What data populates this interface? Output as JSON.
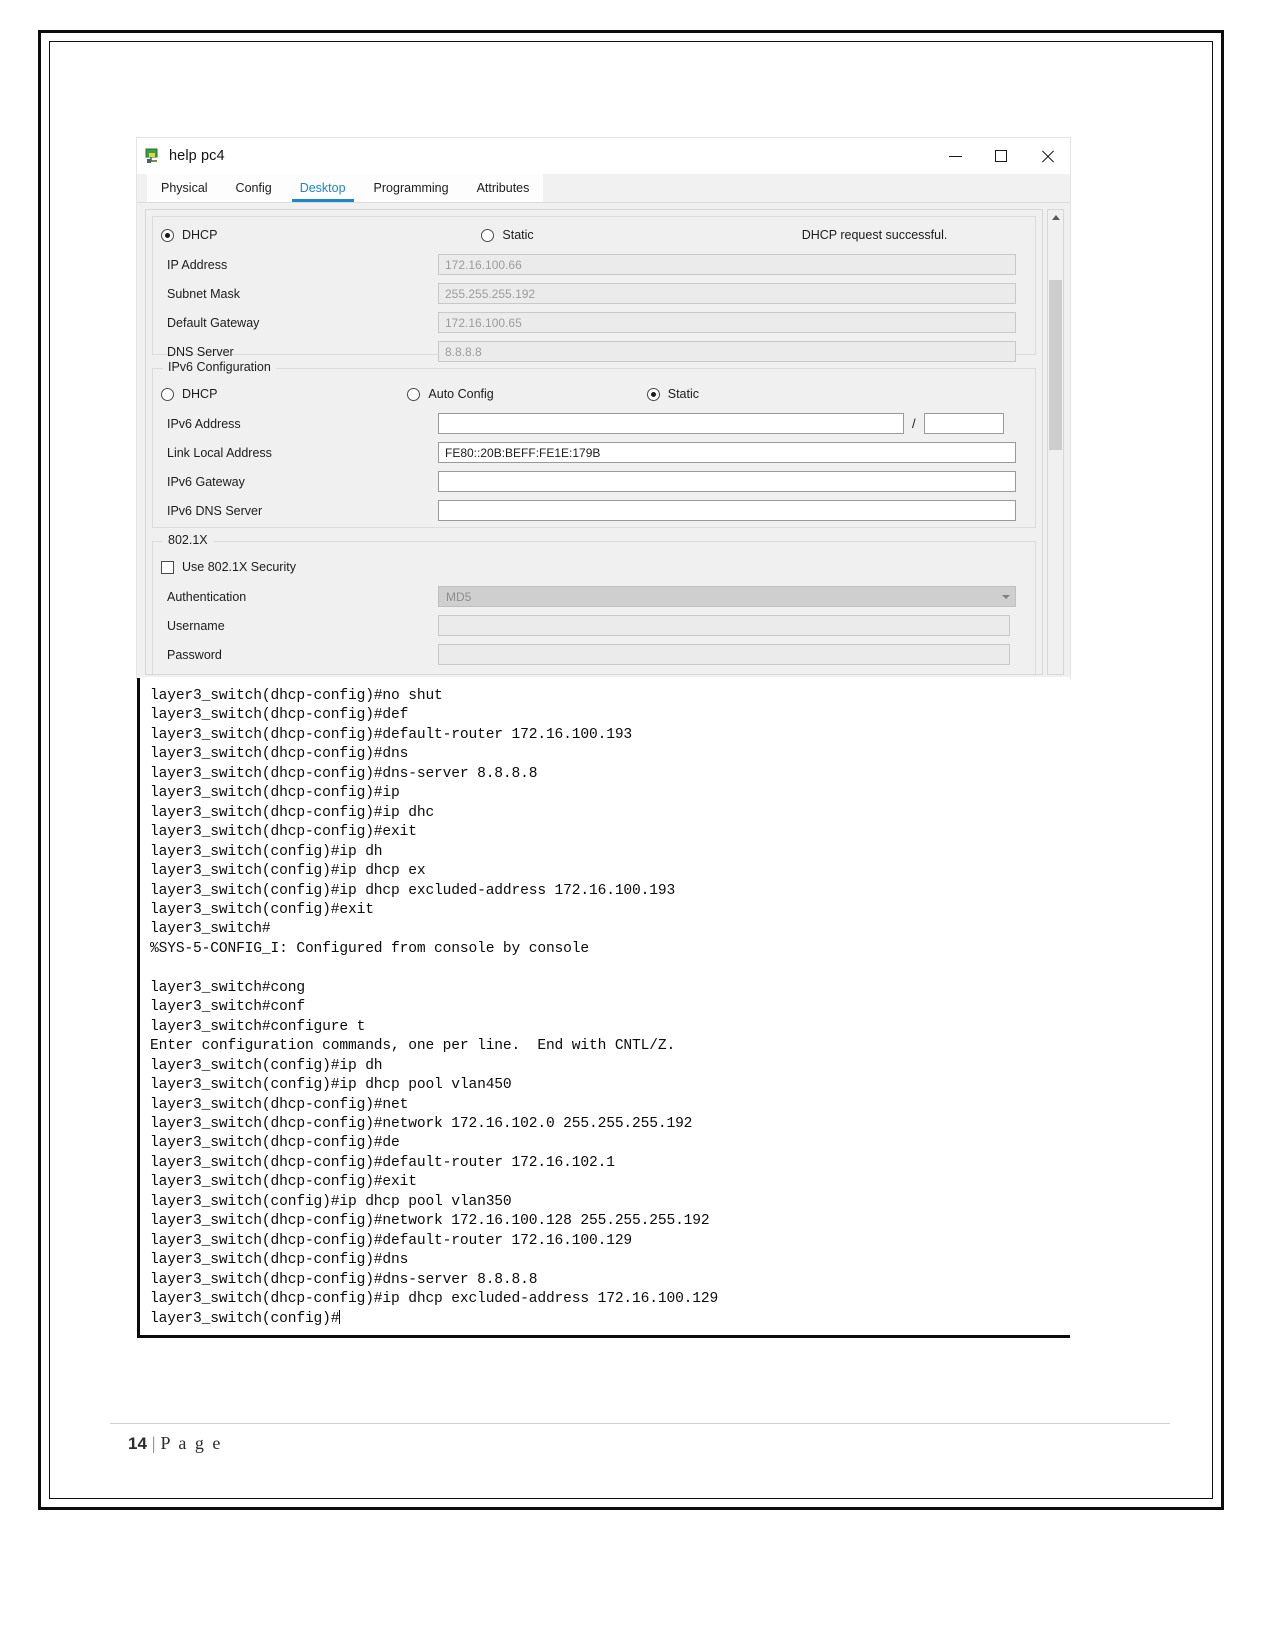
{
  "window": {
    "title": "help pc4",
    "icon": "packet-tracer-device-icon",
    "controls": {
      "minimize": "–",
      "maximize": "□",
      "close": "×"
    },
    "tabs": [
      {
        "label": "Physical",
        "active": false
      },
      {
        "label": "Config",
        "active": false
      },
      {
        "label": "Desktop",
        "active": true
      },
      {
        "label": "Programming",
        "active": false
      },
      {
        "label": "Attributes",
        "active": false
      }
    ],
    "accent_color": "#1d87c9"
  },
  "ip_configuration": {
    "dhcp_label": "DHCP",
    "static_label": "Static",
    "dhcp_selected": true,
    "status_message": "DHCP request successful.",
    "fields": [
      {
        "label": "IP Address",
        "value": "172.16.100.66"
      },
      {
        "label": "Subnet Mask",
        "value": "255.255.255.192"
      },
      {
        "label": "Default Gateway",
        "value": "172.16.100.65"
      },
      {
        "label": "DNS Server",
        "value": "8.8.8.8"
      }
    ]
  },
  "ipv6_configuration": {
    "group_title": "IPv6 Configuration",
    "options": [
      {
        "label": "DHCP",
        "selected": false
      },
      {
        "label": "Auto Config",
        "selected": false
      },
      {
        "label": "Static",
        "selected": true
      }
    ],
    "fields": [
      {
        "label": "IPv6 Address",
        "value": "",
        "has_prefix": true,
        "prefix_value": "",
        "separator": "/"
      },
      {
        "label": "Link Local Address",
        "value": "FE80::20B:BEFF:FE1E:179B",
        "has_prefix": false
      },
      {
        "label": "IPv6 Gateway",
        "value": "",
        "has_prefix": false
      },
      {
        "label": "IPv6 DNS Server",
        "value": "",
        "has_prefix": false
      }
    ]
  },
  "dot1x": {
    "group_title": "802.1X",
    "use_security_label": "Use 802.1X Security",
    "use_security_checked": false,
    "authentication_label": "Authentication",
    "authentication_value": "MD5",
    "username_label": "Username",
    "username_value": "",
    "password_label": "Password",
    "password_value": ""
  },
  "scrollbar": {
    "up_arrow": "scroll-up-arrow",
    "down_arrow": "scroll-down-arrow"
  },
  "terminal": {
    "lines": [
      "layer3_switch(dhcp-config)#no shut",
      "layer3_switch(dhcp-config)#def",
      "layer3_switch(dhcp-config)#default-router 172.16.100.193",
      "layer3_switch(dhcp-config)#dns",
      "layer3_switch(dhcp-config)#dns-server 8.8.8.8",
      "layer3_switch(dhcp-config)#ip",
      "layer3_switch(dhcp-config)#ip dhc",
      "layer3_switch(dhcp-config)#exit",
      "layer3_switch(config)#ip dh",
      "layer3_switch(config)#ip dhcp ex",
      "layer3_switch(config)#ip dhcp excluded-address 172.16.100.193",
      "layer3_switch(config)#exit",
      "layer3_switch#",
      "%SYS-5-CONFIG_I: Configured from console by console",
      "",
      "layer3_switch#cong",
      "layer3_switch#conf",
      "layer3_switch#configure t",
      "Enter configuration commands, one per line.  End with CNTL/Z.",
      "layer3_switch(config)#ip dh",
      "layer3_switch(config)#ip dhcp pool vlan450",
      "layer3_switch(dhcp-config)#net",
      "layer3_switch(dhcp-config)#network 172.16.102.0 255.255.255.192",
      "layer3_switch(dhcp-config)#de",
      "layer3_switch(dhcp-config)#default-router 172.16.102.1",
      "layer3_switch(dhcp-config)#exit",
      "layer3_switch(config)#ip dhcp pool vlan350",
      "layer3_switch(dhcp-config)#network 172.16.100.128 255.255.255.192",
      "layer3_switch(dhcp-config)#default-router 172.16.100.129",
      "layer3_switch(dhcp-config)#dns",
      "layer3_switch(dhcp-config)#dns-server 8.8.8.8",
      "layer3_switch(dhcp-config)#ip dhcp excluded-address 172.16.100.129"
    ],
    "prompt_line": "layer3_switch(config)#"
  },
  "footer": {
    "page_number": "14",
    "separator": "|",
    "page_word": "P a g e"
  }
}
